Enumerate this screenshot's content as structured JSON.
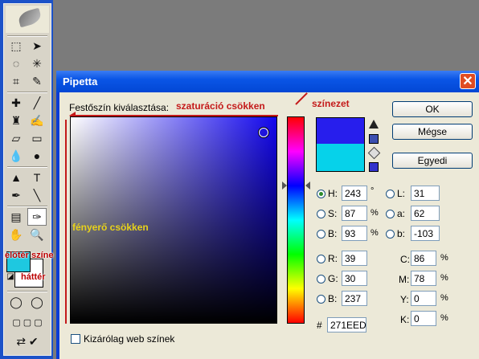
{
  "dialog": {
    "title": "Pipetta",
    "close_glyph": "✕",
    "picker_label": "Festőszín kiválasztása:",
    "buttons": {
      "ok": "OK",
      "cancel": "Mégse",
      "custom": "Egyedi"
    },
    "web_only_label": "Kizárólag web színek",
    "new_color": "#271EED",
    "old_color": "#06D2EA",
    "fields": {
      "H": {
        "label": "H:",
        "value": "243",
        "unit": "°"
      },
      "S": {
        "label": "S:",
        "value": "87",
        "unit": "%"
      },
      "B": {
        "label": "B:",
        "value": "93",
        "unit": "%"
      },
      "R": {
        "label": "R:",
        "value": "39"
      },
      "G": {
        "label": "G:",
        "value": "30"
      },
      "Bl": {
        "label": "B:",
        "value": "237"
      },
      "L": {
        "label": "L:",
        "value": "31"
      },
      "a": {
        "label": "a:",
        "value": "62"
      },
      "b": {
        "label": "b:",
        "value": "-103"
      },
      "C": {
        "label": "C:",
        "value": "86",
        "unit": "%"
      },
      "M": {
        "label": "M:",
        "value": "78",
        "unit": "%"
      },
      "Y": {
        "label": "Y:",
        "value": "0",
        "unit": "%"
      },
      "K": {
        "label": "K:",
        "value": "0",
        "unit": "%"
      }
    },
    "hex_label": "#",
    "hex_value": "271EED",
    "selected_mode": "H"
  },
  "annotations": {
    "saturation": "szaturáció csökken",
    "brightness": "fényerő csökken",
    "hue": "színezet",
    "foreground": "előtér színe",
    "background": "háttér"
  },
  "colors": {
    "title_blue": "#0A55E6",
    "annotation_red": "#C41A1A",
    "annotation_yellow": "#E8D21A"
  }
}
